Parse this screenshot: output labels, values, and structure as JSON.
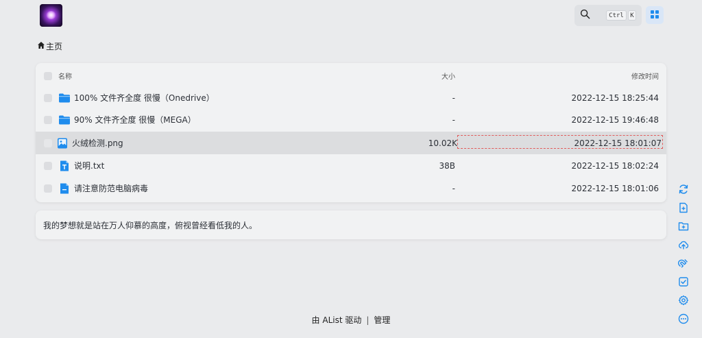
{
  "header": {
    "search_shortcut_ctrl": "Ctrl",
    "search_shortcut_key": "K"
  },
  "breadcrumb": {
    "home_label": "主页"
  },
  "table": {
    "headers": {
      "name": "名称",
      "size": "大小",
      "modified": "修改时间"
    },
    "rows": [
      {
        "name": "100% 文件齐全度 很慢（Onedrive）",
        "size": "-",
        "modified": "2022-12-15 18:25:44",
        "type": "folder"
      },
      {
        "name": "90% 文件齐全度 很慢（MEGA）",
        "size": "-",
        "modified": "2022-12-15 19:46:48",
        "type": "folder"
      },
      {
        "name": "火绒检测.png",
        "size": "10.02K",
        "modified": "2022-12-15 18:01:07",
        "type": "image"
      },
      {
        "name": "说明.txt",
        "size": "38B",
        "modified": "2022-12-15 18:02:24",
        "type": "text"
      },
      {
        "name": "请注意防范电脑病毒",
        "size": "-",
        "modified": "2022-12-15 18:01:06",
        "type": "file"
      }
    ]
  },
  "readme": {
    "text": "我的梦想就是站在万人仰慕的高度，俯视曾经看低我的人。"
  },
  "footer": {
    "driver_link": "由 AList 驱动",
    "separator": "|",
    "manage_link": "管理"
  },
  "colors": {
    "accent": "#1f8ced",
    "background": "#eaebed",
    "card": "#f1f2f3"
  }
}
